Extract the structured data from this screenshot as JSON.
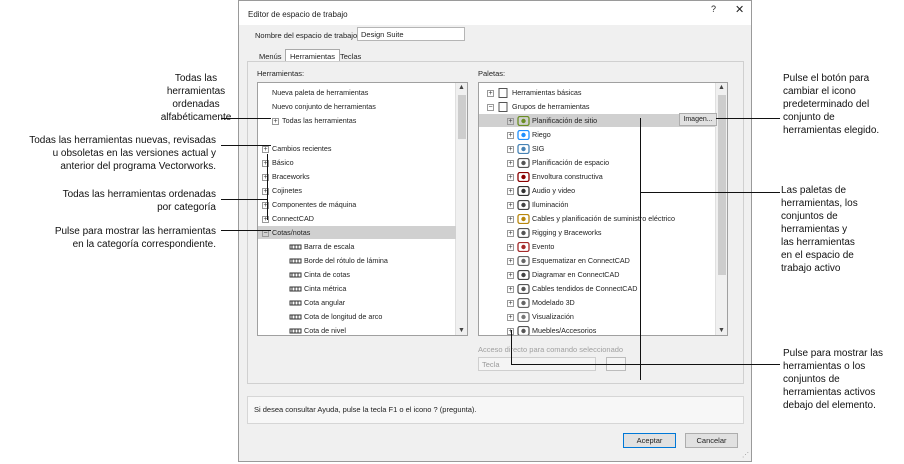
{
  "dialog": {
    "title": "Editor de espacio de trabajo",
    "help_btn": "?",
    "close_btn": "✕",
    "workspace_label": "Nombre del espacio de trabajo:",
    "workspace_value": "Design Suite",
    "tabs": [
      "Menús",
      "Herramientas",
      "Teclas"
    ],
    "active_tab": "Herramientas",
    "tools_label": "Herramientas:",
    "palettes_label": "Paletas:",
    "shortcut_label": "Acceso directo para comando seleccionado",
    "shortcut_placeholder": "Tecla",
    "help_text": "Si desea consultar Ayuda, pulse la tecla F1 o el icono ? (pregunta).",
    "ok_button": "Aceptar",
    "cancel_button": "Cancelar",
    "image_button": "Imagen..."
  },
  "tools_tree": [
    {
      "label": "Nueva paleta de herramientas",
      "expander": ""
    },
    {
      "label": "Nuevo conjunto de herramientas",
      "expander": ""
    },
    {
      "label": "Todas las herramientas",
      "expander": "+"
    },
    {
      "label": "",
      "expander": ""
    },
    {
      "label": "Cambios recientes",
      "expander": "+"
    },
    {
      "label": "Básico",
      "expander": "+"
    },
    {
      "label": "Braceworks",
      "expander": "+"
    },
    {
      "label": "Cojinetes",
      "expander": "+"
    },
    {
      "label": "Componentes de máquina",
      "expander": "+"
    },
    {
      "label": "ConnectCAD",
      "expander": "+"
    },
    {
      "label": "Cotas/notas",
      "expander": "−"
    },
    {
      "label": "Barra de escala",
      "expander": ""
    },
    {
      "label": "Borde del rótulo de lámina",
      "expander": ""
    },
    {
      "label": "Cinta de cotas",
      "expander": ""
    },
    {
      "label": "Cinta métrica",
      "expander": ""
    },
    {
      "label": "Cota angular",
      "expander": ""
    },
    {
      "label": "Cota de longitud de arco",
      "expander": ""
    },
    {
      "label": "Cota de nivel",
      "expander": ""
    }
  ],
  "palettes_tree": [
    {
      "label": "Herramientas básicas",
      "expander": "+"
    },
    {
      "label": "Grupos de herramientas",
      "expander": "−"
    },
    {
      "label": "Planificación de sitio",
      "expander": "+"
    },
    {
      "label": "Riego",
      "expander": "+"
    },
    {
      "label": "SIG",
      "expander": "+"
    },
    {
      "label": "Planificación de espacio",
      "expander": "+"
    },
    {
      "label": "Envoltura constructiva",
      "expander": "+"
    },
    {
      "label": "Audio y video",
      "expander": "+"
    },
    {
      "label": "Iluminación",
      "expander": "+"
    },
    {
      "label": "Cables y planificación de suministro eléctrico",
      "expander": "+"
    },
    {
      "label": "Rigging y Braceworks",
      "expander": "+"
    },
    {
      "label": "Evento",
      "expander": "+"
    },
    {
      "label": "Esquematizar en ConnectCAD",
      "expander": "+"
    },
    {
      "label": "Diagramar en ConnectCAD",
      "expander": "+"
    },
    {
      "label": "Cables tendidos de ConnectCAD",
      "expander": "+"
    },
    {
      "label": "Modelado 3D",
      "expander": "+"
    },
    {
      "label": "Visualización",
      "expander": "+"
    },
    {
      "label": "Muebles/Accesorios",
      "expander": "+"
    }
  ],
  "callouts": {
    "c1": "Todas las\nherramientas\nordenadas\nalfabéticamente",
    "c2": "Todas las herramientas nuevas, revisadas\nu obsoletas en las versiones actual y\nanterior del programa Vectorworks.",
    "c3": "Todas las herramientas ordenadas\npor categoría",
    "c4": "Pulse para mostrar las herramientas\nen la categoría correspondiente.",
    "c5": "Pulse el botón para\ncambiar el icono\npredeterminado del\nconjunto de\nherramientas elegido.",
    "c6": "Las paletas de\nherramientas, los\nconjuntos de\nherramientas y\nlas herramientas\nen el espacio de\ntrabajo activo",
    "c7": "Pulse para mostrar las\nherramientas o los\nconjuntos de\nherramientas activos\ndebajo del elemento."
  }
}
